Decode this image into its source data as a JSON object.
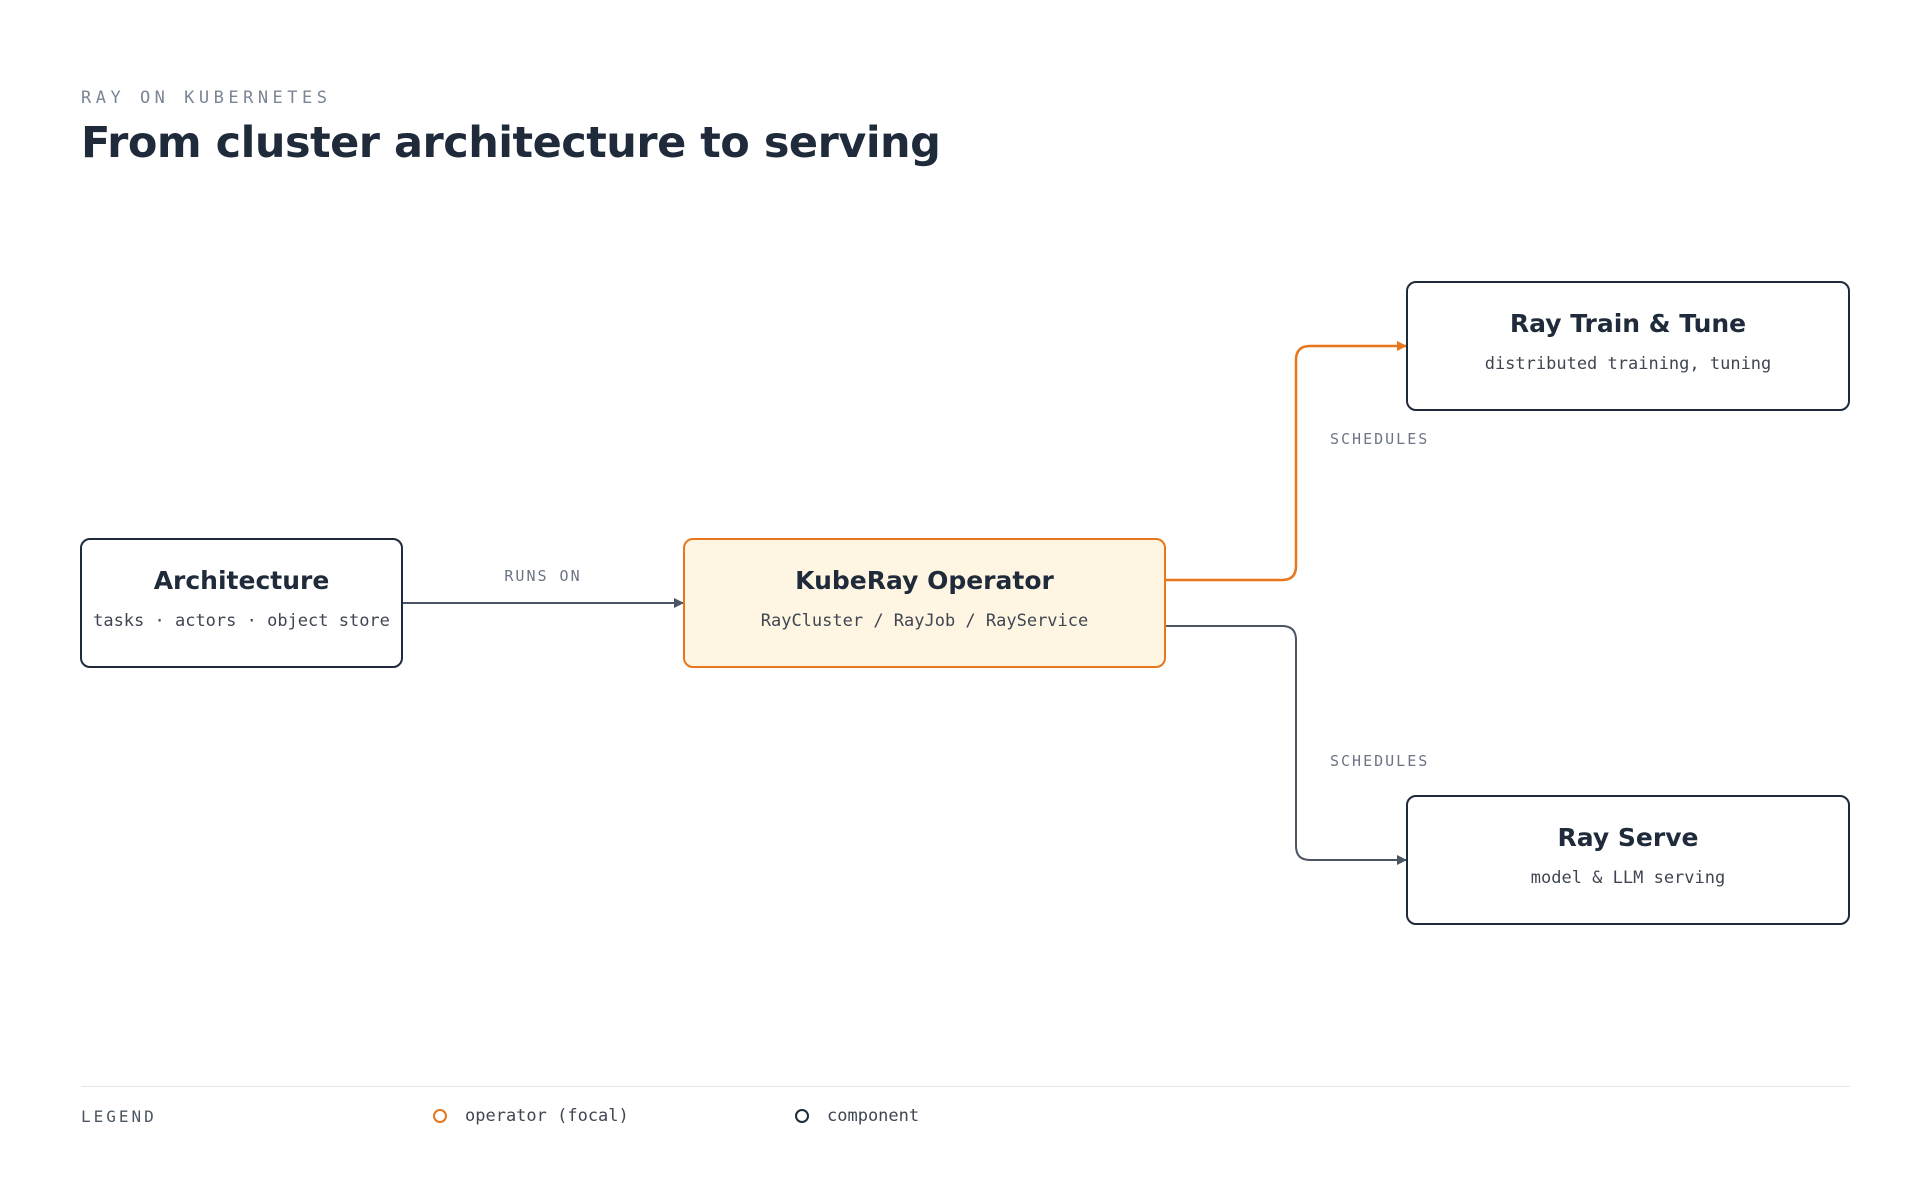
{
  "header": {
    "eyebrow": "RAY ON KUBERNETES",
    "title": "From cluster architecture to serving"
  },
  "colors": {
    "focal": "#e8761c",
    "focal_fill": "#fff5e3",
    "component": "#1f2a3a",
    "edge": "#4b5563"
  },
  "nodes": {
    "architecture": {
      "title": "Architecture",
      "subtitle": "tasks · actors · object store",
      "role": "component"
    },
    "operator": {
      "title": "KubeRay Operator",
      "subtitle": "RayCluster / RayJob / RayService",
      "role": "focal"
    },
    "train": {
      "title": "Ray Train & Tune",
      "subtitle": "distributed training, tuning",
      "role": "component"
    },
    "serve": {
      "title": "Ray Serve",
      "subtitle": "model & LLM serving",
      "role": "component"
    }
  },
  "edges": [
    {
      "from": "architecture",
      "to": "operator",
      "label": "RUNS ON",
      "style": "component"
    },
    {
      "from": "operator",
      "to": "train",
      "label": "SCHEDULES",
      "style": "focal"
    },
    {
      "from": "operator",
      "to": "serve",
      "label": "SCHEDULES",
      "style": "component"
    }
  ],
  "legend": {
    "title": "LEGEND",
    "items": [
      {
        "label": "operator (focal)",
        "color": "#e8761c"
      },
      {
        "label": "component",
        "color": "#1f2a3a"
      }
    ]
  }
}
